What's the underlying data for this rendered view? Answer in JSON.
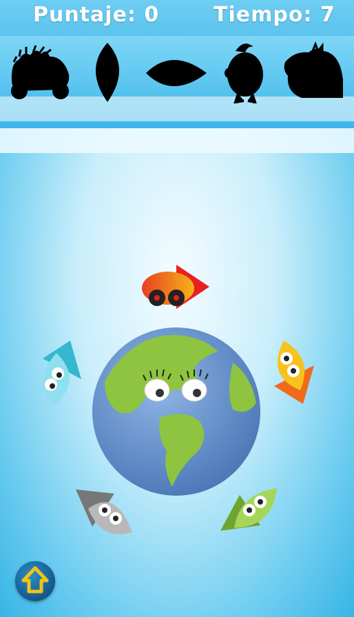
{
  "hud": {
    "score_label": "Puntaje: 0",
    "time_label": "Tiempo: 7"
  },
  "targets": [
    {
      "icon": "car-silhouette"
    },
    {
      "icon": "leaf-silhouette"
    },
    {
      "icon": "fish-silhouette"
    },
    {
      "icon": "chick-silhouette"
    },
    {
      "icon": "bush-silhouette"
    }
  ],
  "pieces": [
    {
      "icon": "red-car-piece",
      "color": "#e8401e"
    },
    {
      "icon": "cyan-drop-piece",
      "color": "#6fd3e6"
    },
    {
      "icon": "orange-drop-piece",
      "color": "#f7a21b"
    },
    {
      "icon": "gray-drop-piece",
      "color": "#a8a8a8"
    },
    {
      "icon": "green-drop-piece",
      "color": "#7cbc3a"
    }
  ],
  "center": {
    "icon": "earth-globe-face"
  },
  "colors": {
    "ocean": "#5d8fcf",
    "land": "#8ec43f"
  },
  "controls": {
    "home_icon": "home-arrow-icon"
  }
}
